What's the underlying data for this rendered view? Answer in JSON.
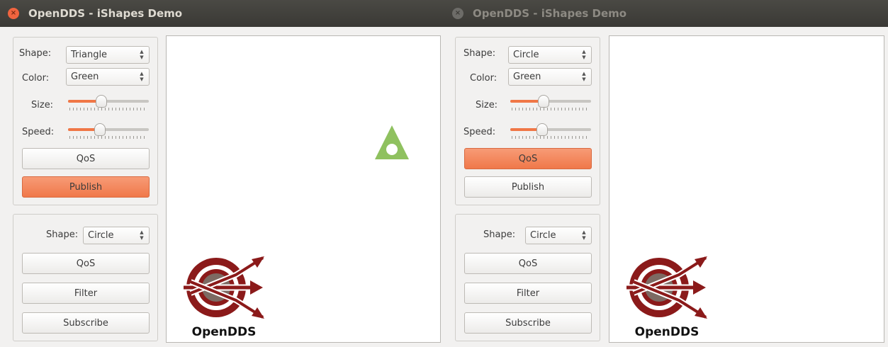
{
  "windows": [
    {
      "title": "OpenDDS - iShapes Demo",
      "close_glyph": "×",
      "publisher": {
        "shape_label": "Shape:",
        "shape_value": "Triangle",
        "color_label": "Color:",
        "color_value": "Green",
        "size_label": "Size:",
        "size_level": 0.4,
        "speed_label": "Speed:",
        "speed_level": 0.38,
        "qos_label": "QoS",
        "qos_active": false,
        "publish_label": "Publish",
        "publish_active": true
      },
      "subscriber": {
        "shape_label": "Shape:",
        "shape_value": "Circle",
        "qos_label": "QoS",
        "filter_label": "Filter",
        "subscribe_label": "Subscribe"
      },
      "canvas": {
        "shapes": [
          {
            "kind": "triangle",
            "color": "#8fc15f"
          }
        ]
      },
      "logo_text": "OpenDDS"
    },
    {
      "title": "OpenDDS - iShapes Demo",
      "close_glyph": "×",
      "publisher": {
        "shape_label": "Shape:",
        "shape_value": "Circle",
        "color_label": "Color:",
        "color_value": "Green",
        "size_label": "Size:",
        "size_level": 0.4,
        "speed_label": "Speed:",
        "speed_level": 0.38,
        "qos_label": "QoS",
        "qos_active": true,
        "publish_label": "Publish",
        "publish_active": false
      },
      "subscriber": {
        "shape_label": "Shape:",
        "shape_value": "Circle",
        "qos_label": "QoS",
        "filter_label": "Filter",
        "subscribe_label": "Subscribe"
      },
      "canvas": {
        "shapes": []
      },
      "logo_text": "OpenDDS"
    }
  ],
  "colors": {
    "accent": "#f0784a",
    "titlebar": "#3c3b37",
    "window_bg": "#f2f1f0",
    "logo_red": "#8b1a1a"
  }
}
